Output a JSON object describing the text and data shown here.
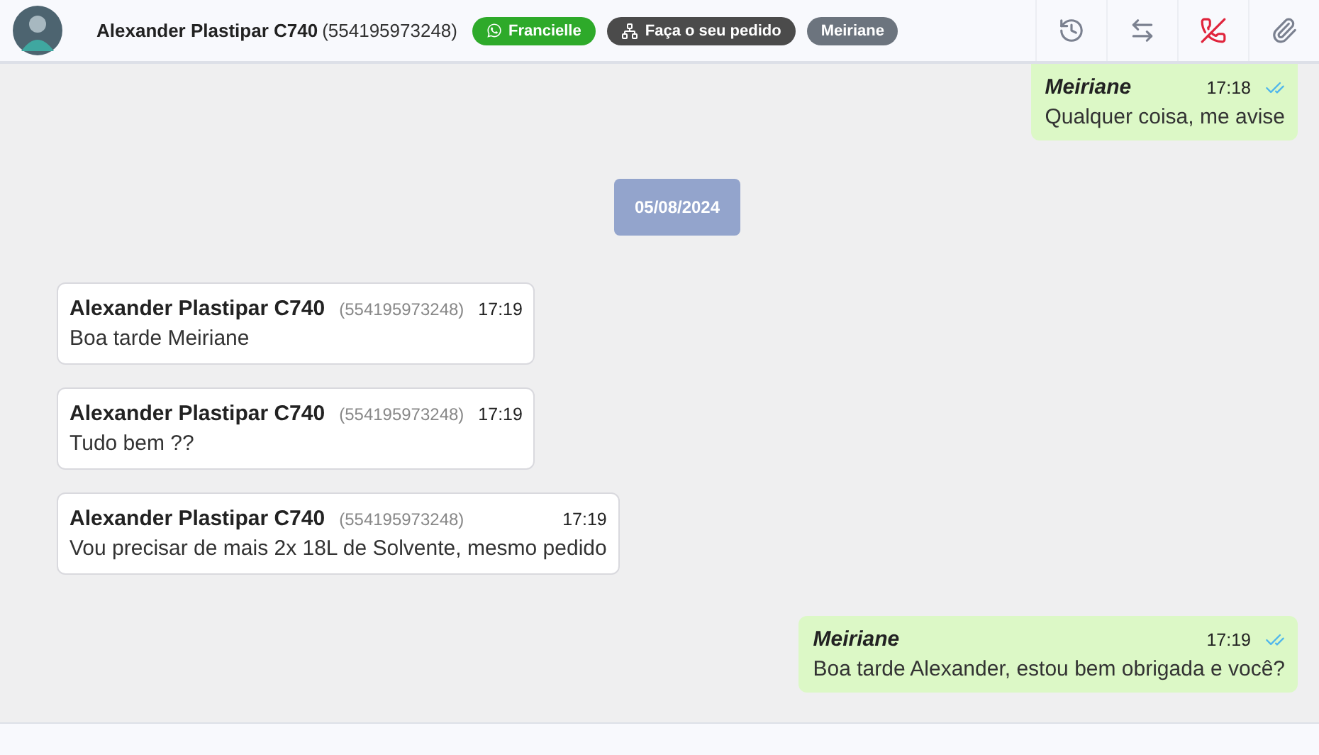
{
  "header": {
    "contact_name": "Alexander Plastipar C740",
    "contact_phone": "(554195973248)",
    "tags": [
      {
        "label": "Francielle",
        "kind": "whatsapp",
        "color": "#2eaa2a"
      },
      {
        "label": "Faça o seu pedido",
        "kind": "network",
        "color": "#4b4b4b"
      },
      {
        "label": "Meiriane",
        "kind": "plain",
        "color": "#6c747e"
      }
    ]
  },
  "messages": [
    {
      "kind": "outgoing",
      "sender": "Meiriane",
      "time": "17:18",
      "text": "Qualquer coisa, me avise",
      "read": true
    },
    {
      "kind": "date",
      "text": "05/08/2024"
    },
    {
      "kind": "incoming",
      "sender": "Alexander Plastipar C740",
      "phone": "(554195973248)",
      "time": "17:19",
      "text": "Boa tarde Meiriane"
    },
    {
      "kind": "incoming",
      "sender": "Alexander Plastipar C740",
      "phone": "(554195973248)",
      "time": "17:19",
      "text": "Tudo bem ??"
    },
    {
      "kind": "incoming",
      "sender": "Alexander Plastipar C740",
      "phone": "(554195973248)",
      "time": "17:19",
      "text": "Vou precisar de mais 2x 18L de Solvente, mesmo pedido"
    },
    {
      "kind": "outgoing",
      "sender": "Meiriane",
      "time": "17:19",
      "text": "Boa tarde Alexander, estou bem obrigada e você?",
      "read": true
    }
  ]
}
